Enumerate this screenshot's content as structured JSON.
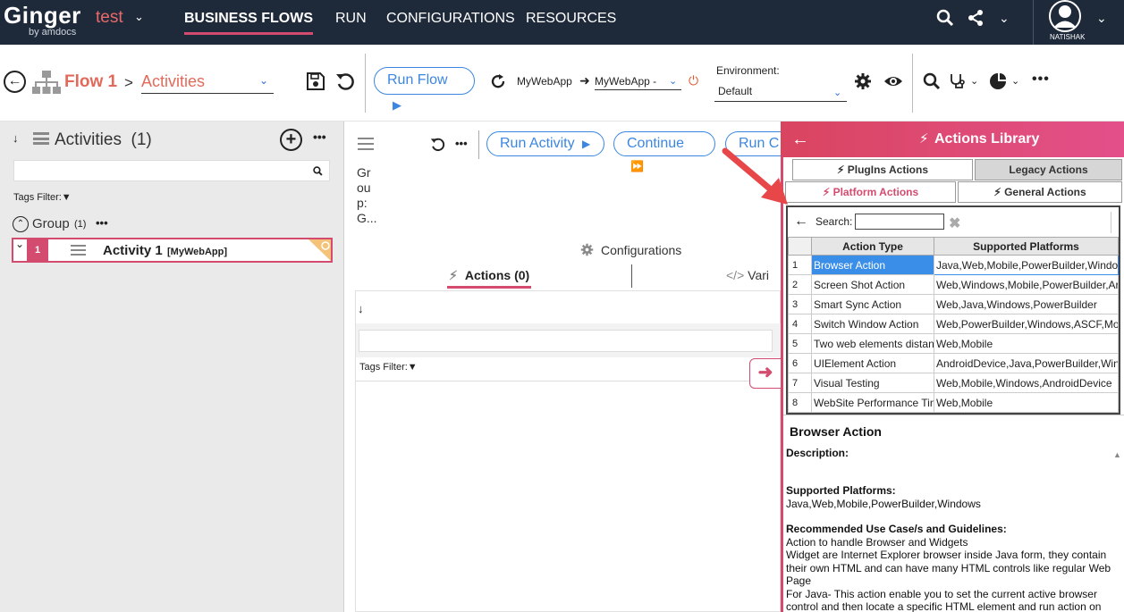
{
  "topnav": {
    "logo": "Ginger",
    "logo_sub": "by amdocs",
    "solution": "test",
    "items": [
      "BUSINESS FLOWS",
      "RUN",
      "CONFIGURATIONS",
      "RESOURCES"
    ],
    "user": "NATISHAK",
    "colors": {
      "bg": "#1e2a3a",
      "accent": "#d34b6e"
    }
  },
  "toolbar": {
    "flow_name": "Flow 1",
    "breadcrumb_sep": ">",
    "breadcrumb_view": "Activities",
    "run_flow": "Run Flow",
    "target_app": "MyWebApp",
    "agent": "MyWebApp -",
    "env_label": "Environment:",
    "env_value": "Default"
  },
  "activities_panel": {
    "title": "Activities",
    "count": "(1)",
    "tags_filter": "Tags Filter:",
    "group_name": "Group",
    "group_count": "(1)",
    "activity": {
      "index": "1",
      "name": "Activity 1",
      "app": "[MyWebApp]"
    }
  },
  "activity_panel": {
    "run_activity": "Run Activity",
    "continue": "Continue",
    "run_c": "Run C",
    "group_text": "Gr ou p: G...",
    "configurations": "Configurations",
    "actions_tab": "Actions (0)",
    "variables_tab": "Vari",
    "tags_filter": "Tags Filter:"
  },
  "actions_library": {
    "title": "Actions Library",
    "tabs": {
      "plugins": "PlugIns Actions",
      "legacy": "Legacy Actions",
      "platform": "Platform Actions",
      "general": "General Actions"
    },
    "search_label": "Search:",
    "columns": [
      "Action Type",
      "Supported Platforms"
    ],
    "rows": [
      {
        "n": "1",
        "type": "Browser Action",
        "platforms": "Java,Web,Mobile,PowerBuilder,Window"
      },
      {
        "n": "2",
        "type": "Screen Shot Action",
        "platforms": "Web,Windows,Mobile,PowerBuilder,Ar"
      },
      {
        "n": "3",
        "type": "Smart Sync Action",
        "platforms": "Web,Java,Windows,PowerBuilder"
      },
      {
        "n": "4",
        "type": "Switch Window Action",
        "platforms": "Web,PowerBuilder,Windows,ASCF,Mol"
      },
      {
        "n": "5",
        "type": "Two web elements distan",
        "platforms": "Web,Mobile"
      },
      {
        "n": "6",
        "type": "UIElement Action",
        "platforms": "AndroidDevice,Java,PowerBuilder,Winc"
      },
      {
        "n": "7",
        "type": "Visual Testing",
        "platforms": "Web,Mobile,Windows,AndroidDevice"
      },
      {
        "n": "8",
        "type": "WebSite Performance Tin",
        "platforms": "Web,Mobile"
      }
    ],
    "detail": {
      "title": "Browser Action",
      "description_label": "Description:",
      "platforms_label": "Supported Platforms:",
      "platforms_value": "Java,Web,Mobile,PowerBuilder,Windows",
      "guidelines_label": "Recommended Use Case/s and Guidelines:",
      "guidelines_1": "Action to handle Browser and Widgets",
      "guidelines_2": "Widget are Internet Explorer browser inside Java form, they contain their own HTML and can have many HTML controls like regular Web Page",
      "guidelines_3": "For Java- This action enable you to set the current active browser control and then locate a specific HTML element and run action on"
    }
  }
}
